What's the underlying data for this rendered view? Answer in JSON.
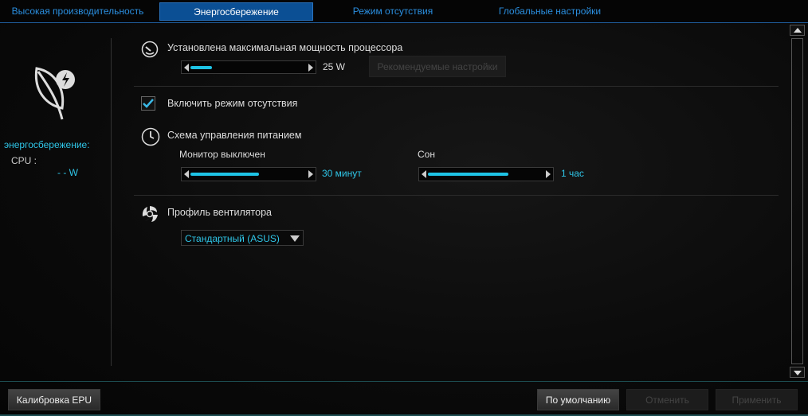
{
  "tabs": [
    {
      "label": "Высокая производительность"
    },
    {
      "label": "Энергосбережение"
    },
    {
      "label": "Режим отсутствия"
    },
    {
      "label": "Глобальные настройки"
    }
  ],
  "left": {
    "mode_label": "энергосбережение:",
    "cpu_label": "CPU :",
    "cpu_value": "- - W"
  },
  "cpu_power": {
    "label": "Установлена максимальная мощность процессора",
    "value": "25 W",
    "slider_percent": 18,
    "recommend_button": "Рекомендуемые настройки"
  },
  "away": {
    "label": "Включить режим отсутствия",
    "checked": true
  },
  "power_scheme": {
    "label": "Схема управления питанием",
    "monitor_label": "Монитор выключен",
    "monitor_value": "30 минут",
    "monitor_percent": 58,
    "sleep_label": "Сон",
    "sleep_value": "1 час",
    "sleep_percent": 68
  },
  "fan": {
    "label": "Профиль вентилятора",
    "selected": "Стандартный (ASUS)"
  },
  "footer": {
    "calibrate": "Калибровка EPU",
    "default": "По умолчанию",
    "cancel": "Отменить",
    "apply": "Применить"
  }
}
